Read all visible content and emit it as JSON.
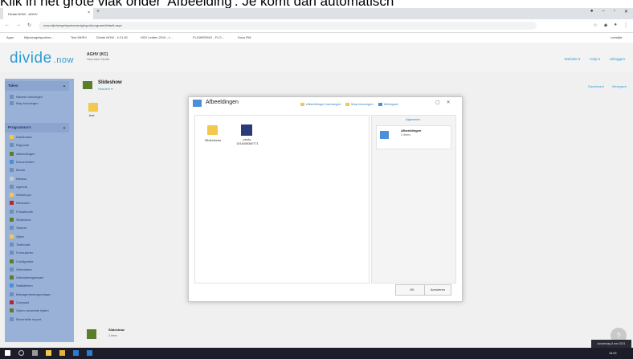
{
  "caption": "Klik in het grote vlak onder 'Afbeelding'. Je komt dan automatisch",
  "browser": {
    "tab_title": "Divide.NOW - AGHV",
    "tab_close": "×",
    "new_tab": "+",
    "url": "now.mijnhengelsportvereniging.nl/program/default.aspx",
    "bookmarks": [
      "Apps",
      "Mijnhengelsportver...",
      "Test MHSV",
      "Divide.NOW - 4.21.82",
      "HSV Leiden 2019 - L...",
      "FLOWERING - FLO...",
      "Docs RM"
    ],
    "reading_list": "Leeslijst"
  },
  "header": {
    "logo": "divide",
    "logo_suffix": ".now",
    "org": "AGHV (KC)",
    "org_sub": "Henneke Strolle",
    "menu": [
      "Website ▾",
      "Help ▾",
      "Uitloggen"
    ]
  },
  "sidebar": {
    "sections": [
      {
        "title": "Taken",
        "items": [
          "Nieuwe toevoegen",
          "Map toevoegen"
        ]
      },
      {
        "title": "Programma's",
        "items": [
          "Dashboard",
          "Rapports",
          "Afbeeldingen",
          "Documenten",
          "Media",
          "Nieuws",
          "Agenda",
          "Webshops",
          "Nieuwsen",
          "Fotoalbums",
          "Slideshow",
          "Vissers",
          "Vijzer",
          "Testimails",
          "Formulieren",
          "Configuratie",
          "Gebruikers",
          "Gebruikersgroepen",
          "Statistieken",
          "Managementrapportage",
          "Compact",
          "Vijzen verwerkte lijsten",
          "Recentelie export"
        ]
      }
    ]
  },
  "page": {
    "title": "Slideshow",
    "subtitle": "Headers ▾",
    "dashboard_link": "Dashboard",
    "weergave_link": "Weergave",
    "bg_folder_label": "test",
    "bottom_title": "Slideshow",
    "bottom_sub": "1 item",
    "help": "?"
  },
  "dialog": {
    "title": "Afbeeldingen",
    "tools": [
      "Afbeeldingen toevoegen",
      "Map toevoegen",
      "Weergave"
    ],
    "items": [
      {
        "label": "Slideshows"
      },
      {
        "label": "photo-1516408360771"
      }
    ],
    "info_header": "Algemeen",
    "info_title": "Afbeeldingen",
    "info_count": "2 items",
    "ok": "OK",
    "cancel": "Annuleren"
  },
  "taskbar": {
    "notification": "donderdag 6 mei 2021",
    "clock": "16:09"
  }
}
